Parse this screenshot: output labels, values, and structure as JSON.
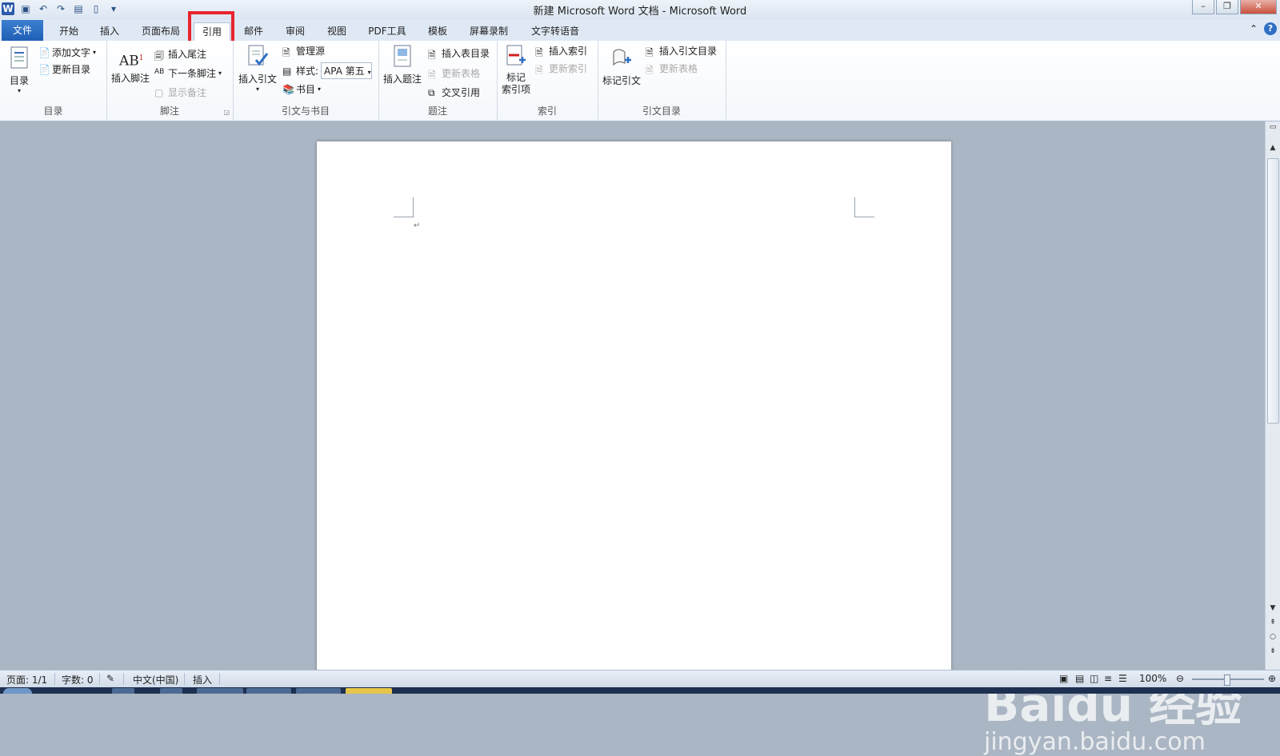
{
  "title_bar": {
    "title": "新建 Microsoft Word 文档 - Microsoft Word",
    "app_icon": "word-icon",
    "quick_access": [
      "save-icon",
      "undo-icon",
      "redo-icon",
      "format-icon",
      "new-doc-icon",
      "customize-icon"
    ]
  },
  "tabs": [
    {
      "label": "文件"
    },
    {
      "label": "开始"
    },
    {
      "label": "插入"
    },
    {
      "label": "页面布局"
    },
    {
      "label": "引用"
    },
    {
      "label": "邮件"
    },
    {
      "label": "审阅"
    },
    {
      "label": "视图"
    },
    {
      "label": "PDF工具"
    },
    {
      "label": "模板"
    },
    {
      "label": "屏幕录制"
    },
    {
      "label": "文字转语音"
    }
  ],
  "active_tab": "引用",
  "ribbon": {
    "toc": {
      "label": "目录",
      "big": "目录",
      "add_text": "添加文字",
      "update": "更新目录"
    },
    "footnote": {
      "label": "脚注",
      "insert": "插入脚注",
      "endnote": "插入尾注",
      "next": "下一条脚注",
      "show": "显示备注"
    },
    "citation": {
      "label": "引文与书目",
      "insert": "插入引文",
      "manage": "管理源",
      "style_label": "样式:",
      "style_value": "APA 第五",
      "bibliography": "书目"
    },
    "caption": {
      "label": "题注",
      "insert": "插入题注",
      "table_of_figures": "插入表目录",
      "update_table": "更新表格",
      "cross_ref": "交叉引用"
    },
    "index": {
      "label": "索引",
      "mark": "标记\n索引项",
      "insert": "插入索引",
      "update": "更新索引"
    },
    "toa": {
      "label": "引文目录",
      "mark": "标记引文",
      "insert": "插入引文目录",
      "update": "更新表格"
    }
  },
  "status": {
    "page": "页面: 1/1",
    "words": "字数: 0",
    "language": "中文(中国)",
    "mode": "插入",
    "zoom": "100%"
  },
  "watermark": {
    "brand": "Baidu 经验",
    "url": "jingyan.baidu.com"
  },
  "colors": {
    "highlight": "#e8242c",
    "file_tab": "#2a63b8",
    "doc_bg": "#abb6c4"
  }
}
